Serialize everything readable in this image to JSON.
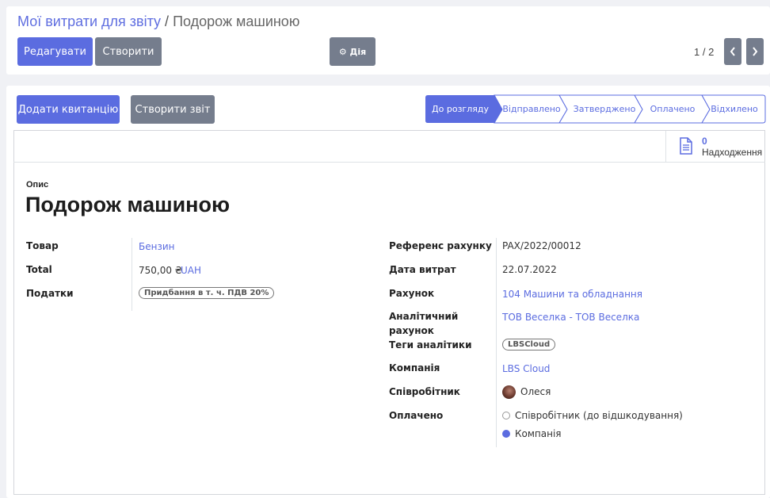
{
  "breadcrumb": {
    "parent": "Мої витрати для звіту",
    "separator": "/",
    "current": "Подорож машиною"
  },
  "toolbar": {
    "edit_label": "Редагувати",
    "create_label": "Створити",
    "action_label": "⚙ Дія"
  },
  "pager": {
    "value": "1 / 2",
    "prev_icon": "chevron-left-icon",
    "next_icon": "chevron-right-icon"
  },
  "header_buttons": {
    "add_receipt": "Додати квитанцію",
    "create_report": "Створити звіт"
  },
  "statusbar": {
    "stages": [
      "До розгляду",
      "Відправлено",
      "Затверджено",
      "Оплачено",
      "Відхилено"
    ],
    "active_index": 0
  },
  "smart_button": {
    "count": "0",
    "label": "Надходження",
    "icon": "document-icon"
  },
  "form": {
    "description_label": "Опис",
    "title": "Подорож машиною",
    "left": {
      "product_label": "Товар",
      "product_value": "Бензин",
      "total_label": "Total",
      "total_amount": "750,00 ₴",
      "total_currency": "UAH",
      "taxes_label": "Податки",
      "taxes_value": "Придбання в т. ч. ПДВ 20%"
    },
    "right": {
      "bill_ref_label": "Референс рахунку",
      "bill_ref_value": "PAX/2022/00012",
      "date_label": "Дата витрат",
      "date_value": "22.07.2022",
      "account_label": "Рахунок",
      "account_value": "104 Машини та обладнання",
      "analytic_label": "Аналітичний рахунок",
      "analytic_value": "ТОВ Веселка - ТОВ Веселка",
      "analytic_tags_label": "Теги аналітики",
      "analytic_tag": "LBSCloud",
      "company_label": "Компанія",
      "company_value": "LBS Cloud",
      "employee_label": "Співробітник",
      "employee_value": "Олеся",
      "paid_label": "Оплачено",
      "paid_options": [
        "Співробітник (до відшкодування)",
        "Компанія"
      ],
      "paid_selected": 1
    }
  },
  "colors": {
    "accent": "#5b6ce0",
    "secondary": "#757d8d"
  }
}
